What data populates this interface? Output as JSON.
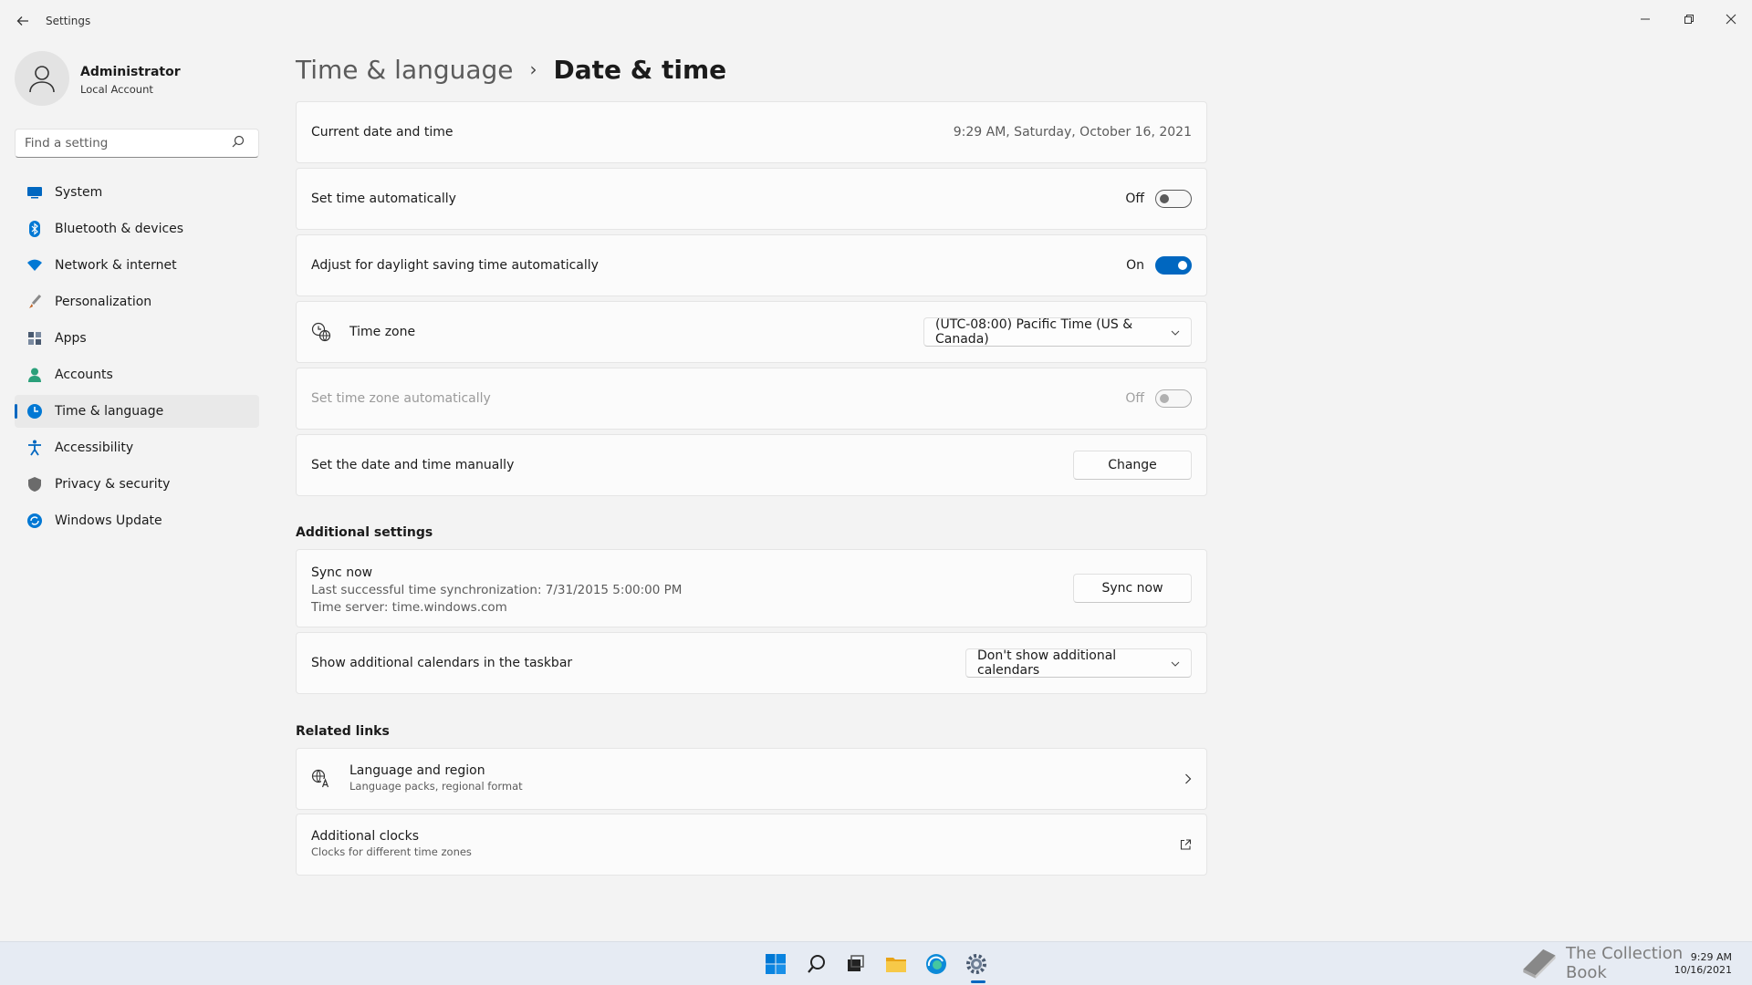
{
  "window": {
    "title": "Settings",
    "back_icon": "back-arrow-icon",
    "min_icon": "minimize-icon",
    "max_icon": "restore-icon",
    "close_icon": "close-icon"
  },
  "user": {
    "name": "Administrator",
    "account_type": "Local Account"
  },
  "search": {
    "placeholder": "Find a setting",
    "value": ""
  },
  "sidebar": {
    "items": [
      {
        "label": "System",
        "icon": "monitor-icon",
        "color": "#0067c0",
        "selected": false
      },
      {
        "label": "Bluetooth & devices",
        "icon": "bluetooth-icon",
        "color": "#0078d4",
        "selected": false
      },
      {
        "label": "Network & internet",
        "icon": "wifi-icon",
        "color": "#0078d4",
        "selected": false
      },
      {
        "label": "Personalization",
        "icon": "brush-icon",
        "color": "#c06020",
        "selected": false
      },
      {
        "label": "Apps",
        "icon": "apps-icon",
        "color": "#4a5a70",
        "selected": false
      },
      {
        "label": "Accounts",
        "icon": "person-icon",
        "color": "#2aa07a",
        "selected": false
      },
      {
        "label": "Time & language",
        "icon": "globe-clock-icon",
        "color": "#0078d4",
        "selected": true
      },
      {
        "label": "Accessibility",
        "icon": "accessibility-icon",
        "color": "#0067c0",
        "selected": false
      },
      {
        "label": "Privacy & security",
        "icon": "shield-icon",
        "color": "#6b6b6b",
        "selected": false
      },
      {
        "label": "Windows Update",
        "icon": "update-icon",
        "color": "#0078d4",
        "selected": false
      }
    ]
  },
  "breadcrumb": {
    "parent": "Time & language",
    "separator": "›",
    "current": "Date & time"
  },
  "rows": {
    "current": {
      "label": "Current date and time",
      "value": "9:29 AM, Saturday, October 16, 2021"
    },
    "auto_time": {
      "label": "Set time automatically",
      "state": "Off",
      "on": false
    },
    "dst": {
      "label": "Adjust for daylight saving time automatically",
      "state": "On",
      "on": true
    },
    "timezone": {
      "label": "Time zone",
      "value": "(UTC-08:00) Pacific Time (US & Canada)",
      "icon": "globe-clock-icon"
    },
    "auto_tz": {
      "label": "Set time zone automatically",
      "state": "Off",
      "on": false,
      "disabled": true
    },
    "manual": {
      "label": "Set the date and time manually",
      "button": "Change"
    }
  },
  "additional": {
    "title": "Additional settings",
    "sync": {
      "title": "Sync now",
      "last": "Last successful time synchronization: 7/31/2015 5:00:00 PM",
      "server": "Time server: time.windows.com",
      "button": "Sync now"
    },
    "calendars": {
      "label": "Show additional calendars in the taskbar",
      "value": "Don't show additional calendars"
    }
  },
  "related": {
    "title": "Related links",
    "language": {
      "title": "Language and region",
      "subtitle": "Language packs, regional format",
      "icon": "language-icon"
    },
    "clocks": {
      "title": "Additional clocks",
      "subtitle": "Clocks for different time zones",
      "icon": "open-external-icon"
    }
  },
  "taskbar": {
    "apps": [
      "start-icon",
      "search-icon",
      "task-view-icon",
      "file-explorer-icon",
      "edge-icon",
      "settings-icon"
    ],
    "clock_time": "9:29 AM",
    "clock_date": "10/16/2021",
    "watermark": "The Collection Book"
  }
}
